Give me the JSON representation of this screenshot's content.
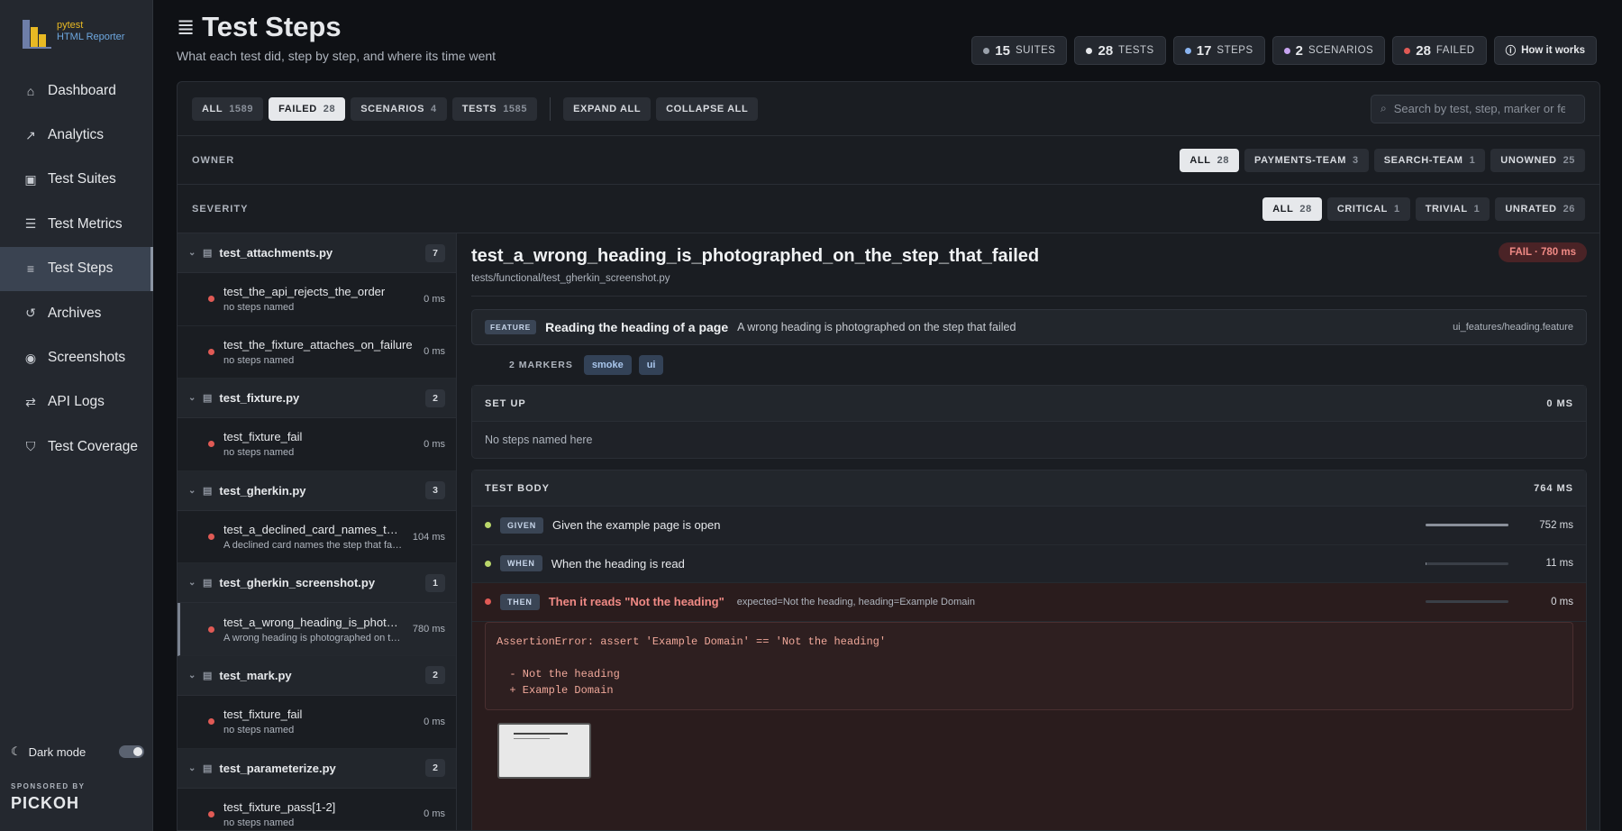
{
  "brand": {
    "name": "pytest",
    "sub": "HTML Reporter"
  },
  "nav": [
    {
      "label": "Dashboard",
      "icon": "home-icon",
      "glyph": "⌂",
      "active": false
    },
    {
      "label": "Analytics",
      "icon": "chart-line-icon",
      "glyph": "↗",
      "active": false
    },
    {
      "label": "Test Suites",
      "icon": "briefcase-icon",
      "glyph": "▣",
      "active": false
    },
    {
      "label": "Test Metrics",
      "icon": "server-icon",
      "glyph": "☰",
      "active": false
    },
    {
      "label": "Test Steps",
      "icon": "list-ordered-icon",
      "glyph": "≡",
      "active": true
    },
    {
      "label": "Archives",
      "icon": "history-icon",
      "glyph": "↺",
      "active": false
    },
    {
      "label": "Screenshots",
      "icon": "camera-icon",
      "glyph": "◉",
      "active": false
    },
    {
      "label": "API Logs",
      "icon": "exchange-icon",
      "glyph": "⇄",
      "active": false
    },
    {
      "label": "Test Coverage",
      "icon": "shield-icon",
      "glyph": "⛉",
      "active": false
    }
  ],
  "dark_mode": {
    "label": "Dark mode",
    "on": true
  },
  "sponsor": {
    "label": "SPONSORED BY",
    "name": "PICKOH"
  },
  "header": {
    "title": "Test Steps",
    "subtitle": "What each test did, step by step, and where its time went",
    "stats": [
      {
        "value": "15",
        "label": "SUITES",
        "color": "#9aa1ab"
      },
      {
        "value": "28",
        "label": "TESTS",
        "color": "#e6e8eb"
      },
      {
        "value": "17",
        "label": "STEPS",
        "color": "#8ab4f0"
      },
      {
        "value": "2",
        "label": "SCENARIOS",
        "color": "#c7a4f0"
      },
      {
        "value": "28",
        "label": "FAILED",
        "color": "#e05a55"
      }
    ],
    "how_it_works": "How it works"
  },
  "filters": {
    "tabs": [
      {
        "label": "ALL",
        "count": "1589",
        "selected": false
      },
      {
        "label": "FAILED",
        "count": "28",
        "selected": true
      },
      {
        "label": "SCENARIOS",
        "count": "4",
        "selected": false
      },
      {
        "label": "TESTS",
        "count": "1585",
        "selected": false
      }
    ],
    "expand_all": "EXPAND ALL",
    "collapse_all": "COLLAPSE ALL",
    "search_placeholder": "Search by test, step, marker or feature"
  },
  "owner": {
    "label": "OWNER",
    "chips": [
      {
        "label": "ALL",
        "count": "28",
        "selected": true
      },
      {
        "label": "PAYMENTS-TEAM",
        "count": "3",
        "selected": false
      },
      {
        "label": "SEARCH-TEAM",
        "count": "1",
        "selected": false
      },
      {
        "label": "UNOWNED",
        "count": "25",
        "selected": false
      }
    ]
  },
  "severity": {
    "label": "SEVERITY",
    "chips": [
      {
        "label": "ALL",
        "count": "28",
        "selected": true
      },
      {
        "label": "CRITICAL",
        "count": "1",
        "selected": false
      },
      {
        "label": "TRIVIAL",
        "count": "1",
        "selected": false
      },
      {
        "label": "UNRATED",
        "count": "26",
        "selected": false
      }
    ]
  },
  "files": [
    {
      "name": "test_attachments.py",
      "count": "7",
      "tests": [
        {
          "name": "test_the_api_rejects_the_order",
          "desc": "no steps named",
          "dur": "0 ms",
          "selected": false
        },
        {
          "name": "test_the_fixture_attaches_on_failure",
          "desc": "no steps named",
          "dur": "0 ms",
          "selected": false
        }
      ]
    },
    {
      "name": "test_fixture.py",
      "count": "2",
      "tests": [
        {
          "name": "test_fixture_fail",
          "desc": "no steps named",
          "dur": "0 ms",
          "selected": false
        }
      ]
    },
    {
      "name": "test_gherkin.py",
      "count": "3",
      "tests": [
        {
          "name": "test_a_declined_card_names_the_step_that_failed",
          "desc": "A declined card names the step that failed",
          "dur": "104 ms",
          "selected": false
        }
      ]
    },
    {
      "name": "test_gherkin_screenshot.py",
      "count": "1",
      "tests": [
        {
          "name": "test_a_wrong_heading_is_photographed_on_the_step_that_failed",
          "desc": "A wrong heading is photographed on the step that failed",
          "dur": "780 ms",
          "selected": true
        }
      ]
    },
    {
      "name": "test_mark.py",
      "count": "2",
      "tests": [
        {
          "name": "test_fixture_fail",
          "desc": "no steps named",
          "dur": "0 ms",
          "selected": false
        }
      ]
    },
    {
      "name": "test_parameterize.py",
      "count": "2",
      "tests": [
        {
          "name": "test_fixture_pass[1-2]",
          "desc": "no steps named",
          "dur": "0 ms",
          "selected": false
        }
      ]
    }
  ],
  "detail": {
    "title": "test_a_wrong_heading_is_photographed_on_the_step_that_failed",
    "path": "tests/functional/test_gherkin_screenshot.py",
    "status": "FAIL · 780 ms",
    "feature": {
      "tag": "FEATURE",
      "name": "Reading the heading of a page",
      "desc": "A wrong heading is photographed on the step that failed",
      "file": "ui_features/heading.feature"
    },
    "markers": {
      "label": "2 MARKERS",
      "items": [
        "smoke",
        "ui"
      ]
    },
    "setup": {
      "label": "SET UP",
      "dur": "0 MS",
      "empty": "No steps named here"
    },
    "body": {
      "label": "TEST BODY",
      "dur": "764 MS"
    },
    "steps": [
      {
        "keyword": "GIVEN",
        "text": "Given the example page is open",
        "args": "",
        "dur": "752 ms",
        "fraction": 1.0,
        "status": "pass",
        "color": "#b9d66a"
      },
      {
        "keyword": "WHEN",
        "text": "When the heading is read",
        "args": "",
        "dur": "11 ms",
        "fraction": 0.015,
        "status": "pass",
        "color": "#b9d66a"
      },
      {
        "keyword": "THEN",
        "text": "Then it reads \"Not the heading\"",
        "args": "expected=Not the heading, heading=Example Domain",
        "dur": "0 ms",
        "fraction": 0.0,
        "status": "fail",
        "color": "#e05a55"
      }
    ],
    "error": "AssertionError: assert 'Example Domain' == 'Not the heading'\n\n  - Not the heading\n  + Example Domain"
  }
}
